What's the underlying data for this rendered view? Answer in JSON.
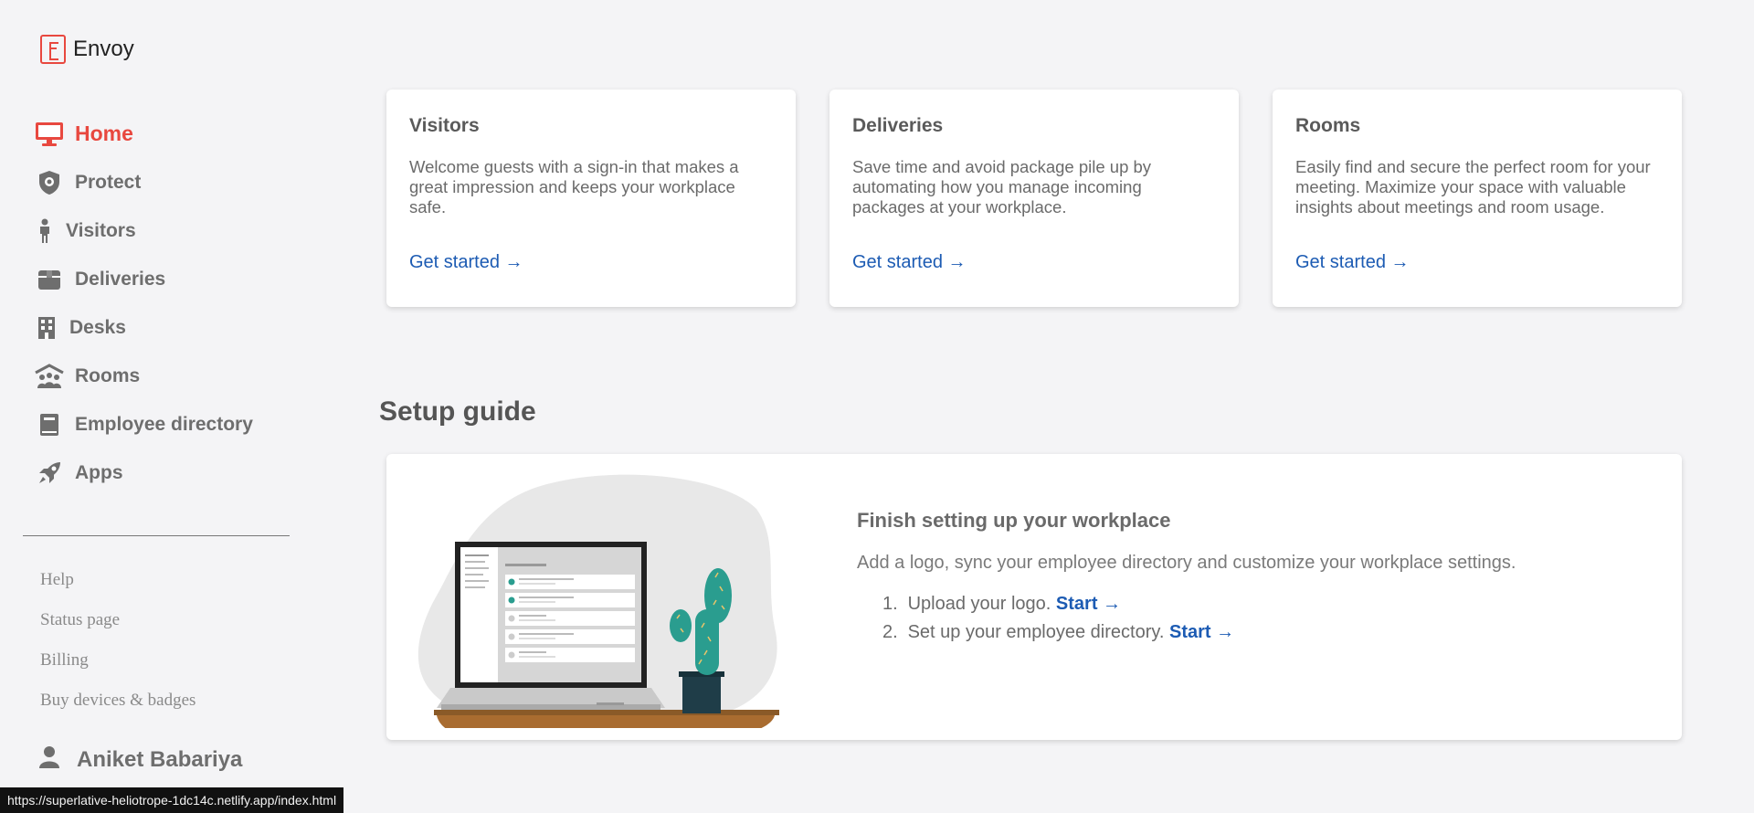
{
  "brand": {
    "name": "Envoy",
    "accent": "#e8483f",
    "link_color": "#1c5bb3"
  },
  "nav": {
    "items": [
      {
        "label": "Home",
        "icon": "monitor-icon",
        "active": true
      },
      {
        "label": "Protect",
        "icon": "shield-icon"
      },
      {
        "label": "Visitors",
        "icon": "person-icon"
      },
      {
        "label": "Deliveries",
        "icon": "package-icon"
      },
      {
        "label": "Desks",
        "icon": "building-icon"
      },
      {
        "label": "Rooms",
        "icon": "people-room-icon"
      },
      {
        "label": "Employee directory",
        "icon": "book-icon"
      },
      {
        "label": "Apps",
        "icon": "rocket-icon"
      }
    ]
  },
  "footer_links": [
    "Help",
    "Status page",
    "Billing",
    "Buy devices & badges"
  ],
  "user": {
    "name": "Aniket Babariya",
    "icon": "user-icon"
  },
  "status_url": "https://superlative-heliotrope-1dc14c.netlify.app/index.html",
  "cards": [
    {
      "title": "Visitors",
      "description": "Welcome guests with a sign-in that makes a great impression and keeps your workplace safe.",
      "link": "Get started →"
    },
    {
      "title": "Deliveries",
      "description": "Save time and avoid package pile up by automating how you manage incoming packages at your workplace.",
      "link": "Get started →"
    },
    {
      "title": "Rooms",
      "description": "Easily find and secure the perfect room for your meeting. Maximize your space with valuable insights about meetings and room usage.",
      "link": "Get started →"
    }
  ],
  "setup": {
    "section_title": "Setup guide",
    "heading": "Finish setting up your workplace",
    "description": "Add a logo, sync your employee directory and customize your workplace settings.",
    "steps": [
      {
        "num": "1.",
        "text": "Upload your logo.",
        "link": "Start →"
      },
      {
        "num": "2.",
        "text": "Set up your employee directory.",
        "link": "Start →"
      }
    ]
  }
}
